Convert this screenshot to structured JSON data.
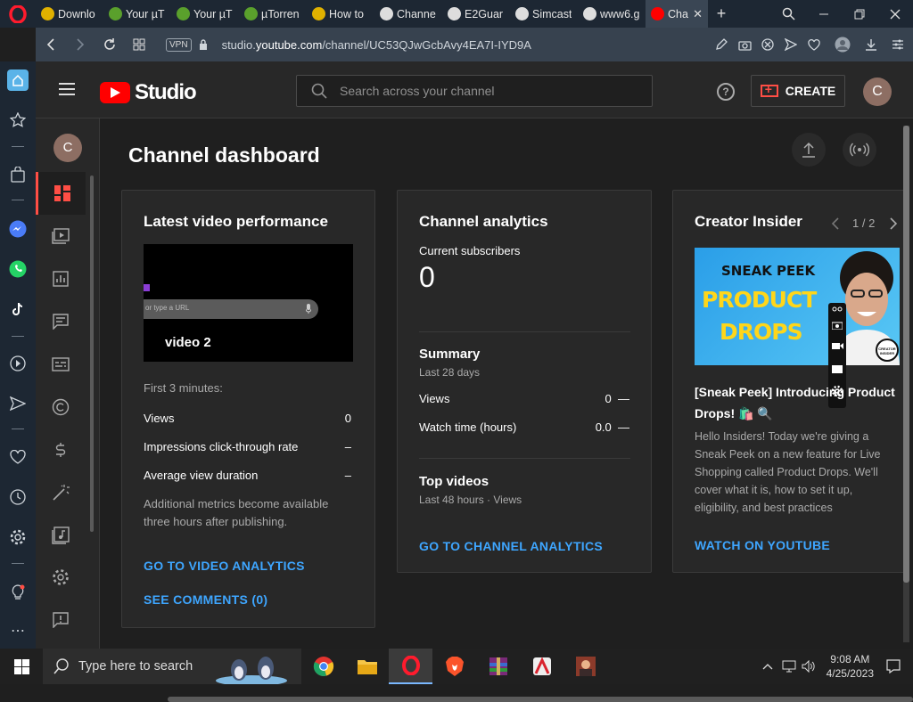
{
  "browser": {
    "tabs": [
      {
        "title": "Downlo",
        "color": "#e0b100"
      },
      {
        "title": "Your µT",
        "color": "#5aa02c"
      },
      {
        "title": "Your µT",
        "color": "#5aa02c"
      },
      {
        "title": "µTorren",
        "color": "#5aa02c"
      },
      {
        "title": "How to",
        "color": "#e0b100"
      },
      {
        "title": "Channe",
        "color": "#dddddd"
      },
      {
        "title": "E2Guar",
        "color": "#dddddd"
      },
      {
        "title": "Simcast",
        "color": "#dddddd"
      },
      {
        "title": "www6.g",
        "color": "#dddddd"
      },
      {
        "title": "Cha",
        "color": "#ff0000"
      }
    ],
    "new_tab": "+",
    "address": {
      "vpn": "VPN",
      "url_prefix": "studio.",
      "url_domain": "youtube.com",
      "url_path": "/channel/UC53QJwGcbAvy4EA7I-IYD9A"
    }
  },
  "studio": {
    "logo_text": "Studio",
    "search_placeholder": "Search across your channel",
    "help": "?",
    "create_label": "CREATE",
    "avatar_letter": "C",
    "nav_avatar_letter": "C",
    "page_title": "Channel dashboard"
  },
  "latest_video": {
    "title": "Latest video performance",
    "video_title": "video 2",
    "thumb_input_text": "or type a URL",
    "first_minutes": "First 3 minutes:",
    "metrics": [
      {
        "label": "Views",
        "value": "0"
      },
      {
        "label": "Impressions click-through rate",
        "value": "–"
      },
      {
        "label": "Average view duration",
        "value": "–"
      }
    ],
    "note": "Additional metrics become available three hours after publishing.",
    "link_analytics": "GO TO VIDEO ANALYTICS",
    "link_comments": "SEE COMMENTS (0)"
  },
  "channel_analytics": {
    "title": "Channel analytics",
    "subs_label": "Current subscribers",
    "subs_value": "0",
    "summary_title": "Summary",
    "summary_period": "Last 28 days",
    "summary_rows": [
      {
        "label": "Views",
        "value": "0",
        "trend": "—"
      },
      {
        "label": "Watch time (hours)",
        "value": "0.0",
        "trend": "—"
      }
    ],
    "top_videos_title": "Top videos",
    "top_videos_period": "Last 48 hours · Views",
    "link": "GO TO CHANNEL ANALYTICS"
  },
  "creator_insider": {
    "title": "Creator Insider",
    "pager": "1 / 2",
    "thumb_line1": "SNEAK PEEK",
    "thumb_line2": "PRODUCT",
    "thumb_line3": "DROPS",
    "badge": "CREATOR INSIDER",
    "headline": "[Sneak Peek] Introducing Product Drops! 🛍️ 🔍",
    "body": "Hello Insiders! Today we're giving a Sneak Peek on a new feature for Live Shopping called Product Drops. We'll cover what it is, how to set it up, eligibility, and best practices",
    "link": "WATCH ON YOUTUBE"
  },
  "taskbar": {
    "search_placeholder": "Type here to search",
    "time": "9:08 AM",
    "date": "4/25/2023"
  }
}
